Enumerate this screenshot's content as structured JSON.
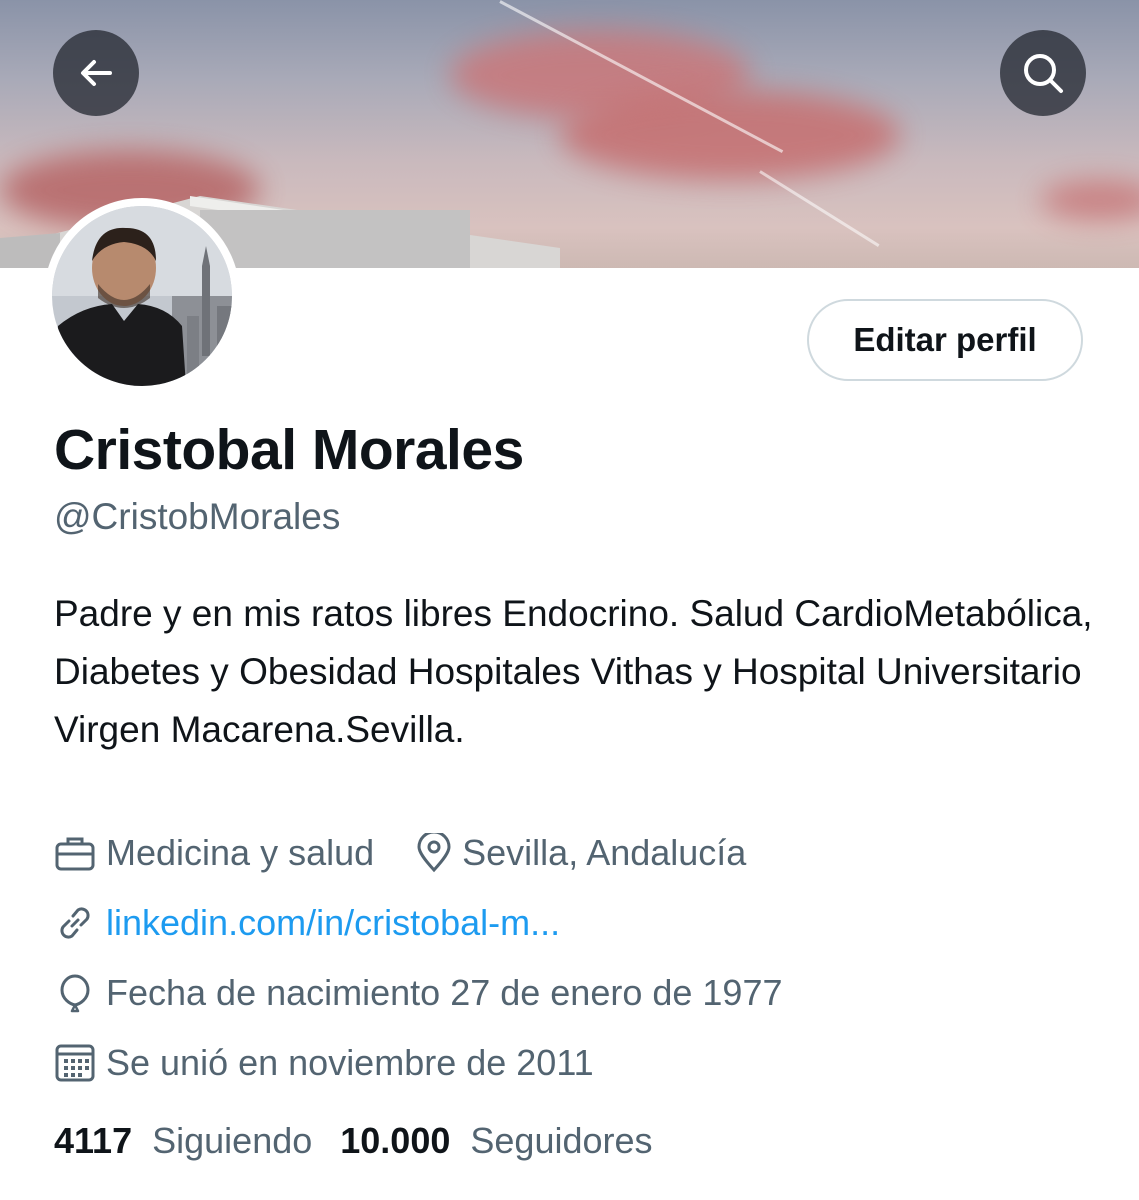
{
  "header": {
    "back_icon": "arrow-left-icon",
    "search_icon": "search-icon"
  },
  "profile": {
    "name": "Cristobal Morales",
    "handle": "@CristobMorales",
    "edit_button_label": "Editar perfil",
    "bio": "Padre y en mis ratos libres Endocrino. Salud CardioMetabólica, Diabetes y Obesidad Hospitales Vithas y Hospital Universitario Virgen Macarena.Sevilla.",
    "category": "Medicina y salud",
    "location": "Sevilla, Andalucía",
    "website": "linkedin.com/in/cristobal-m...",
    "birthdate": "Fecha de nacimiento 27 de enero de 1977",
    "joined": "Se unió en noviembre de 2011"
  },
  "stats": {
    "following_count": "4117",
    "following_label": "Siguiendo",
    "followers_count": "10.000",
    "followers_label": "Seguidores"
  },
  "colors": {
    "accent": "#1d9bf0",
    "secondary_text": "#536471",
    "primary_text": "#0f1419"
  }
}
